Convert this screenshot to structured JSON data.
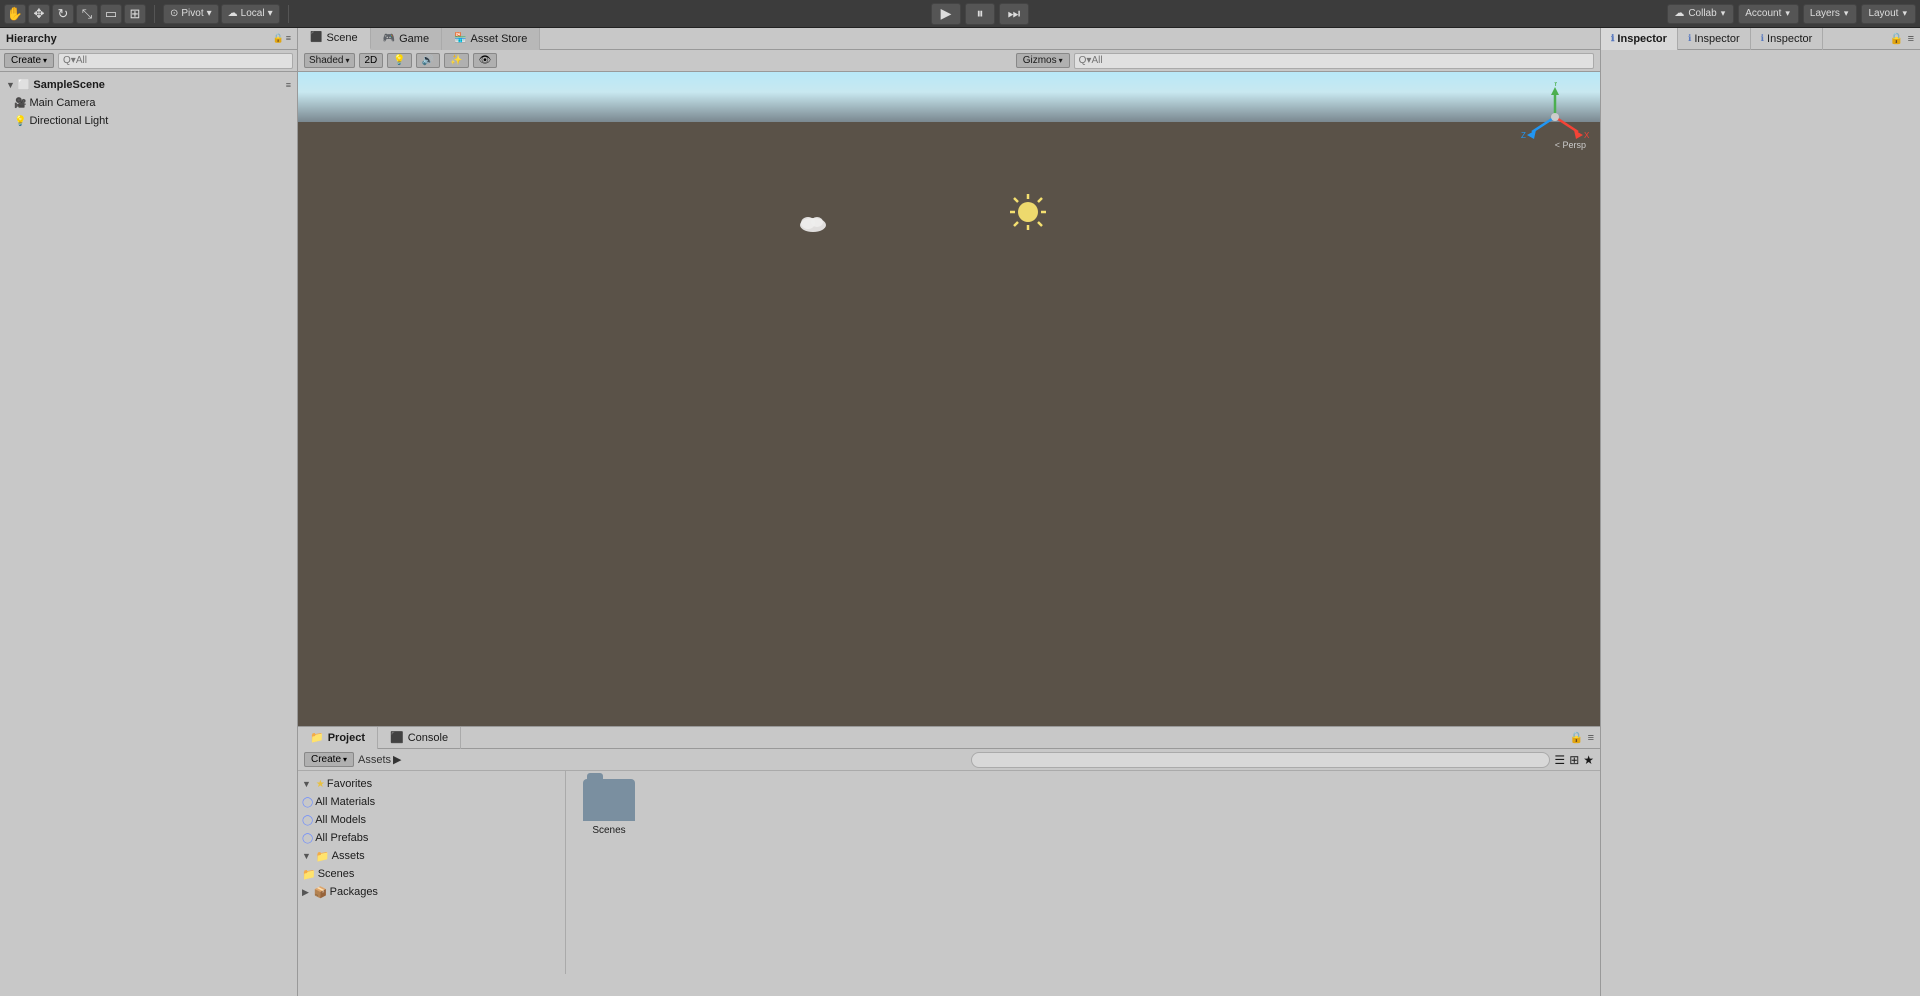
{
  "toolbar": {
    "pivot_label": "Pivot",
    "local_label": "Local",
    "collab_label": "Collab",
    "account_label": "Account",
    "layers_label": "Layers",
    "layout_label": "Layout"
  },
  "hierarchy": {
    "title": "Hierarchy",
    "create_label": "Create",
    "search_placeholder": "Q▾All",
    "scene_name": "SampleScene",
    "items": [
      {
        "label": "Main Camera",
        "icon": "🎥"
      },
      {
        "label": "Directional Light",
        "icon": "💡"
      }
    ]
  },
  "scene": {
    "tabs": [
      {
        "label": "Scene",
        "icon": "⬛"
      },
      {
        "label": "Game",
        "icon": "🎮"
      },
      {
        "label": "Asset Store",
        "icon": "🏪"
      }
    ],
    "shading": "Shaded",
    "mode": "2D",
    "gizmos_label": "Gizmos",
    "search_placeholder": "Q▾All",
    "persp_label": "< Persp"
  },
  "inspector": {
    "tabs": [
      {
        "label": "Inspector",
        "icon": "ℹ"
      },
      {
        "label": "Inspector",
        "icon": "ℹ"
      },
      {
        "label": "Inspector",
        "icon": "ℹ"
      }
    ]
  },
  "project": {
    "tab_project": "Project",
    "tab_console": "Console",
    "create_label": "Create",
    "search_placeholder": "",
    "favorites": {
      "label": "Favorites",
      "items": [
        {
          "label": "All Materials"
        },
        {
          "label": "All Models"
        },
        {
          "label": "All Prefabs"
        }
      ]
    },
    "assets": {
      "label": "Assets",
      "items": [
        {
          "label": "Scenes"
        }
      ]
    },
    "packages": {
      "label": "Packages"
    },
    "assets_path": "Assets",
    "folders": [
      {
        "label": "Scenes"
      }
    ]
  }
}
